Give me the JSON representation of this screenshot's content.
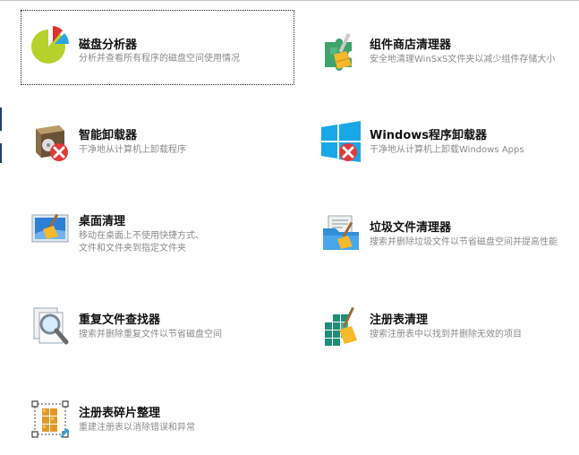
{
  "tools": [
    {
      "id": "disk-analyzer",
      "title": "磁盘分析器",
      "desc": "分析并查看所有程序的磁盘空间使用情况",
      "icon": "pie-chart-icon",
      "selected": true
    },
    {
      "id": "component-store-cleaner",
      "title": "组件商店清理器",
      "desc": "安全地清理WinSxS文件夹以减少组件存储大小",
      "icon": "puzzle-broom-icon",
      "selected": false
    },
    {
      "id": "smart-uninstaller",
      "title": "智能卸载器",
      "desc": "干净地从计算机上卸载程序",
      "icon": "software-box-delete-icon",
      "selected": false
    },
    {
      "id": "windows-apps-uninstaller",
      "title": "Windows程序卸载器",
      "desc": "干净地从计算机上卸载Windows Apps",
      "icon": "windows-logo-delete-icon",
      "selected": false
    },
    {
      "id": "desktop-cleaner",
      "title": "桌面清理",
      "desc": "移动在桌面上不使用快捷方式、\n文件和文件夹到指定文件夹",
      "icon": "desktop-broom-icon",
      "selected": false
    },
    {
      "id": "junk-file-cleaner",
      "title": "垃圾文件清理器",
      "desc": "搜索并删除垃圾文件以节省磁盘空间并提高性能",
      "icon": "folder-broom-icon",
      "selected": false
    },
    {
      "id": "duplicate-file-finder",
      "title": "重复文件查找器",
      "desc": "搜索并删除重复文件以节省磁盘空间",
      "icon": "magnifier-document-icon",
      "selected": false
    },
    {
      "id": "registry-cleaner",
      "title": "注册表清理",
      "desc": "搜索注册表中以找到并删除无效的项目",
      "icon": "registry-broom-icon",
      "selected": false
    },
    {
      "id": "registry-defrag",
      "title": "注册表碎片整理",
      "desc": "重建注册表以消除错误和异常",
      "icon": "registry-cubes-icon",
      "selected": false
    }
  ],
  "colors": {
    "title": "#111111",
    "desc": "#8b8b8b",
    "accent_blue": "#1ea0e6",
    "delete_red": "#e03a3a"
  }
}
